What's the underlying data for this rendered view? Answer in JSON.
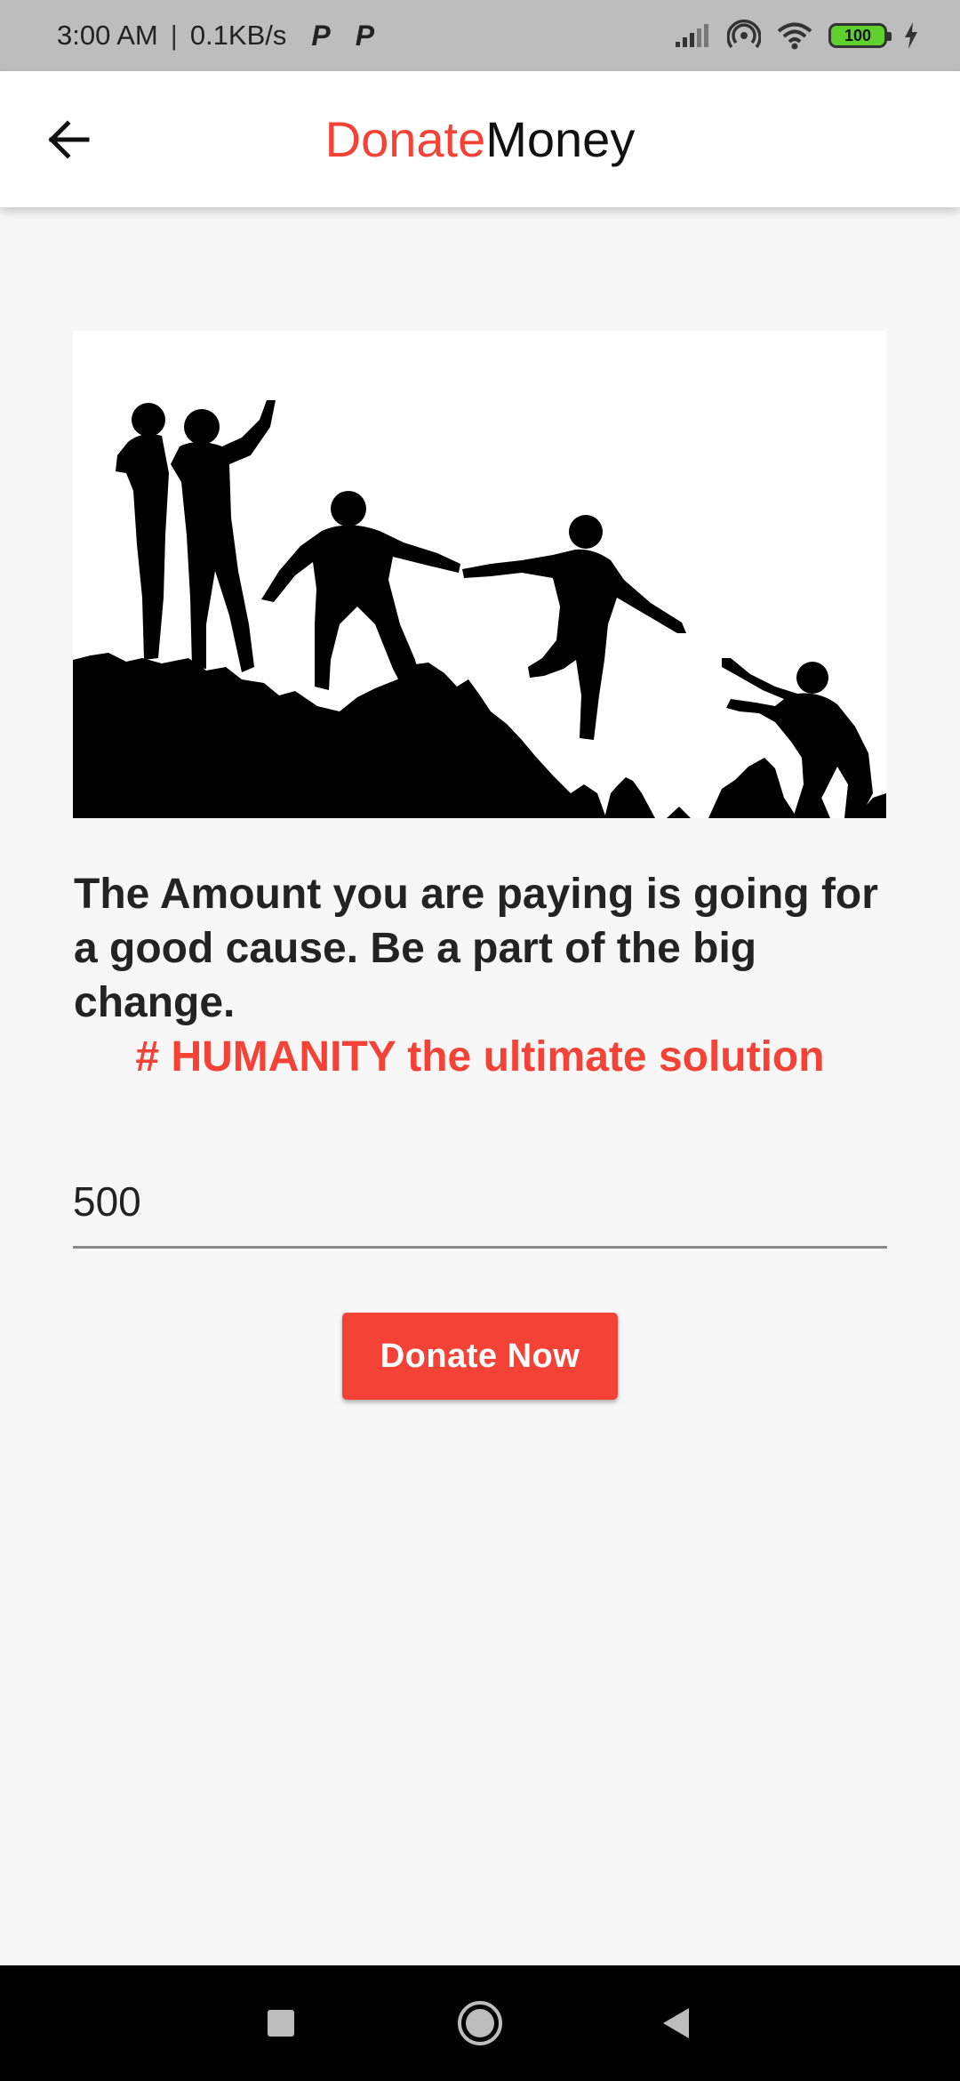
{
  "status_bar": {
    "time": "3:00 AM",
    "separator": "|",
    "speed": "0.1KB/s",
    "notif_1": "P",
    "notif_2": "P",
    "battery": "100",
    "icons": [
      "signal-icon",
      "hotspot-icon",
      "wifi-icon",
      "battery-icon",
      "charging-icon"
    ]
  },
  "app_bar": {
    "title_part_1": "Donate",
    "title_part_2": "Money",
    "back_icon": "arrow-left-icon",
    "title_colors": {
      "part_1": "#f44336",
      "part_2": "#111111"
    }
  },
  "hero": {
    "icon": "people-silhouette-illustration"
  },
  "content": {
    "message": "The Amount you are paying is going for a good cause. Be a part of the big change.",
    "hashtag": "# HUMANITY the ultimate solution"
  },
  "form": {
    "amount_value": "500",
    "donate_label": "Donate Now"
  },
  "colors": {
    "accent": "#f44336",
    "background": "#f7f7f7",
    "status_bar": "#bdbdbd"
  },
  "nav_bar": {
    "icons": [
      "recents-square-icon",
      "home-circle-icon",
      "back-triangle-icon"
    ]
  }
}
